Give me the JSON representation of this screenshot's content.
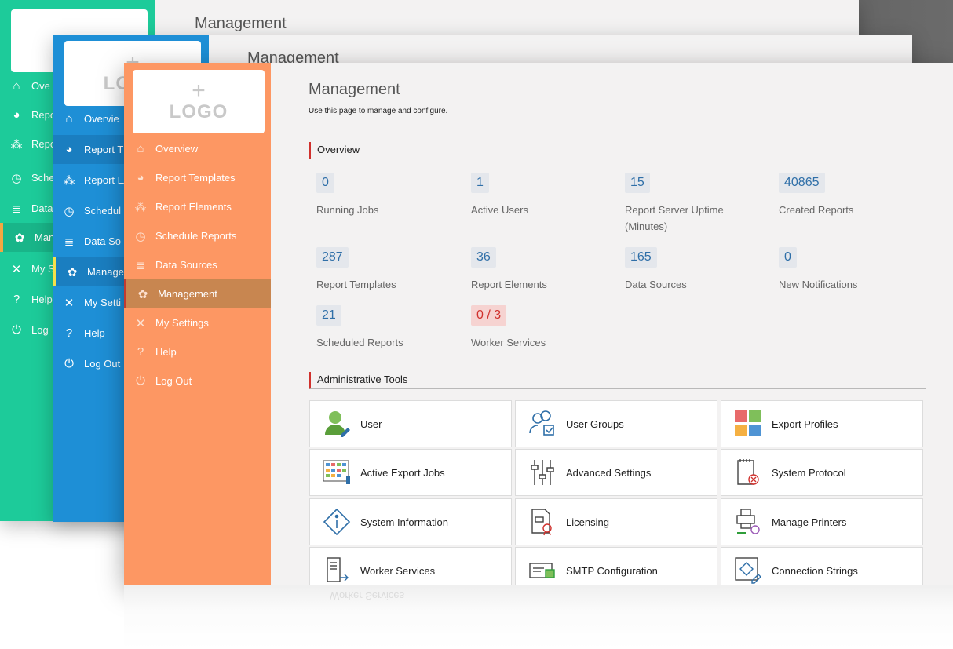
{
  "logo": {
    "plus": "+",
    "text": "LOGO"
  },
  "nav": [
    {
      "label": "Overview",
      "icon": "home-icon"
    },
    {
      "label": "Report Templates",
      "icon": "report-templates-icon"
    },
    {
      "label": "Report Elements",
      "icon": "report-elements-icon"
    },
    {
      "label": "Schedule Reports",
      "icon": "schedule-icon"
    },
    {
      "label": "Data Sources",
      "icon": "database-icon"
    },
    {
      "label": "Management",
      "icon": "gear-icon"
    },
    {
      "label": "My Settings",
      "icon": "settings-tools-icon"
    },
    {
      "label": "Help",
      "icon": "help-icon"
    },
    {
      "label": "Log Out",
      "icon": "power-icon"
    }
  ],
  "back_window_1": {
    "title": "Management",
    "nav_labels": [
      "Ove",
      "Repo",
      "Repo",
      "Sche",
      "Data",
      "Man",
      "My S",
      "Help",
      "Log"
    ]
  },
  "back_window_2": {
    "title": "Management",
    "nav_labels": [
      "Overvie",
      "Report T",
      "Report E",
      "Schedul",
      "Data So",
      "Manage",
      "My Setti",
      "Help",
      "Log Out"
    ]
  },
  "main": {
    "title": "Management",
    "subtitle": "Use this page to manage and configure.",
    "overview_heading": "Overview",
    "stats": [
      {
        "value": "0",
        "label": "Running Jobs"
      },
      {
        "value": "1",
        "label": "Active Users"
      },
      {
        "value": "15",
        "label": "Report Server Uptime (Minutes)"
      },
      {
        "value": "40865",
        "label": "Created Reports"
      },
      {
        "value": "287",
        "label": "Report Templates"
      },
      {
        "value": "36",
        "label": "Report Elements"
      },
      {
        "value": "165",
        "label": "Data Sources"
      },
      {
        "value": "0",
        "label": "New Notifications"
      },
      {
        "value": "21",
        "label": "Scheduled Reports"
      },
      {
        "value": "0 / 3",
        "label": "Worker Services",
        "status": "warning"
      }
    ],
    "tools_heading": "Administrative Tools",
    "tools": [
      {
        "label": "User",
        "icon": "user-edit-icon"
      },
      {
        "label": "User Groups",
        "icon": "user-groups-icon"
      },
      {
        "label": "Export Profiles",
        "icon": "export-profiles-icon"
      },
      {
        "label": "Active Export Jobs",
        "icon": "active-export-jobs-icon"
      },
      {
        "label": "Advanced Settings",
        "icon": "sliders-icon"
      },
      {
        "label": "System Protocol",
        "icon": "system-protocol-icon"
      },
      {
        "label": "System Information",
        "icon": "info-diamond-icon"
      },
      {
        "label": "Licensing",
        "icon": "licensing-certificate-icon"
      },
      {
        "label": "Manage Printers",
        "icon": "printer-icon"
      },
      {
        "label": "Worker Services",
        "icon": "worker-services-icon"
      },
      {
        "label": "SMTP Configuration",
        "icon": "smtp-icon"
      },
      {
        "label": "Connection Strings",
        "icon": "connection-strings-icon"
      }
    ]
  },
  "reflection": {
    "text": "Worker Services"
  },
  "colors": {
    "green_sidebar": "#1dcb9a",
    "blue_sidebar": "#1e8fd6",
    "orange_sidebar": "#fd9763",
    "active_orange": "#c88650",
    "accent_red": "#d0312d",
    "stat_value": "#2f6fa8"
  }
}
